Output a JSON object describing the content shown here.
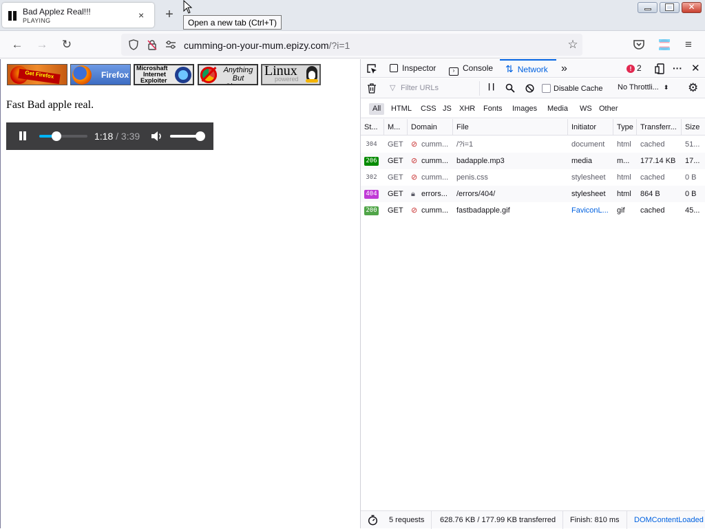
{
  "tab": {
    "title": "Bad Applez Real!!!",
    "subtitle": "PLAYING",
    "close": "×"
  },
  "new_tab": {
    "label": "+",
    "tooltip": "Open a new tab (Ctrl+T)"
  },
  "url": {
    "host": "cumming-on-your-mum.epizy.com",
    "path": "/?i=1"
  },
  "page": {
    "badges": [
      {
        "name": "Get Firefox, n00bs!"
      },
      {
        "name": "Firefox"
      },
      {
        "name": "Microshaft Internet Exploiter"
      },
      {
        "name": "Anything But Chrome"
      },
      {
        "name": "Linux powered"
      }
    ],
    "badge_texts": {
      "firefox": "Firefox",
      "ie_line1": "Microshaft",
      "ie_line2": "Internet",
      "ie_line3": "Exploiter",
      "abc_line1": "Anything",
      "abc_line2": "But Chrome",
      "linux": "Linux",
      "linux_sub": "powered"
    },
    "text": "Fast Bad apple real.",
    "player": {
      "current": "1:18",
      "duration": " / 3:39",
      "progress": 0.36,
      "volume": 0.95
    }
  },
  "devtools": {
    "tabs": {
      "inspector": "Inspector",
      "console": "Console",
      "network": "Network"
    },
    "error_count": "2",
    "filter_placeholder": "Filter URLs",
    "disable_cache": "Disable Cache",
    "throttling": "No Throttli...",
    "types": [
      "All",
      "HTML",
      "CSS",
      "JS",
      "XHR",
      "Fonts",
      "Images",
      "Media",
      "WS",
      "Other"
    ],
    "columns": [
      "St...",
      "M...",
      "Domain",
      "File",
      "Initiator",
      "Type",
      "Transferr...",
      "Size"
    ],
    "rows": [
      {
        "status": "304",
        "method": "GET",
        "domain": "cumm...",
        "file": "/?i=1",
        "initiator": "document",
        "type": "html",
        "transferred": "cached",
        "size": "51..."
      },
      {
        "status": "206",
        "method": "GET",
        "domain": "cumm...",
        "file": "badapple.mp3",
        "initiator": "media",
        "type": "m...",
        "transferred": "177.14 KB",
        "size": "17..."
      },
      {
        "status": "302",
        "method": "GET",
        "domain": "cumm...",
        "file": "penis.css",
        "initiator": "stylesheet",
        "type": "html",
        "transferred": "cached",
        "size": "0 B"
      },
      {
        "status": "404",
        "method": "GET",
        "domain": "errors...",
        "file": "/errors/404/",
        "initiator": "stylesheet",
        "type": "html",
        "transferred": "864 B",
        "size": "0 B"
      },
      {
        "status": "200",
        "method": "GET",
        "domain": "cumm...",
        "file": "fastbadapple.gif",
        "initiator": "FaviconL...",
        "type": "gif",
        "transferred": "cached",
        "size": "45..."
      }
    ],
    "status_bar": {
      "requests": "5 requests",
      "transferred": "628.76 KB / 177.99 KB transferred",
      "finish": "Finish: 810 ms",
      "dcl": "DOMContentLoaded"
    }
  },
  "colors": {
    "accent": "#0061e0",
    "status_206": "#058b00",
    "status_404": "#c03ad6",
    "status_200": "#50a548",
    "status_3xx": "#5b5b66"
  }
}
